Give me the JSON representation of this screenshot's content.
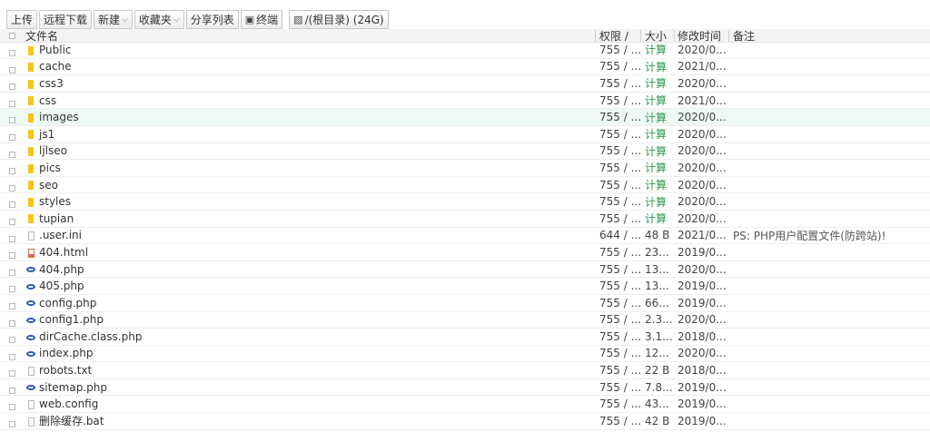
{
  "toolbar": {
    "upload": "上传",
    "remote_download": "远程下载",
    "new": "新建",
    "favorites": "收藏夹",
    "share_list": "分享列表",
    "terminal": "终端",
    "path": "/(根目录) (24G)"
  },
  "header": {
    "name": "文件名",
    "permission": "权限 /",
    "size": "大小",
    "modified": "修改时间",
    "note": "备注"
  },
  "rows": [
    {
      "name": "Public",
      "type": "folder",
      "perm": "755 / ...",
      "size": "计算",
      "time": "2020/0...",
      "note": ""
    },
    {
      "name": "cache",
      "type": "folder",
      "perm": "755 / ...",
      "size": "计算",
      "time": "2021/0...",
      "note": ""
    },
    {
      "name": "css3",
      "type": "folder",
      "perm": "755 / ...",
      "size": "计算",
      "time": "2020/0...",
      "note": ""
    },
    {
      "name": "css",
      "type": "folder",
      "perm": "755 / ...",
      "size": "计算",
      "time": "2021/0...",
      "note": ""
    },
    {
      "name": "images",
      "type": "folder",
      "perm": "755 / ...",
      "size": "计算",
      "time": "2020/0...",
      "note": ""
    },
    {
      "name": "js1",
      "type": "folder",
      "perm": "755 / ...",
      "size": "计算",
      "time": "2020/0...",
      "note": ""
    },
    {
      "name": "ljlseo",
      "type": "folder",
      "perm": "755 / ...",
      "size": "计算",
      "time": "2020/0...",
      "note": ""
    },
    {
      "name": "pics",
      "type": "folder",
      "perm": "755 / ...",
      "size": "计算",
      "time": "2020/0...",
      "note": ""
    },
    {
      "name": "seo",
      "type": "folder",
      "perm": "755 / ...",
      "size": "计算",
      "time": "2020/0...",
      "note": ""
    },
    {
      "name": "styles",
      "type": "folder",
      "perm": "755 / ...",
      "size": "计算",
      "time": "2020/0...",
      "note": ""
    },
    {
      "name": "tupian",
      "type": "folder",
      "perm": "755 / ...",
      "size": "计算",
      "time": "2020/0...",
      "note": ""
    },
    {
      "name": ".user.ini",
      "type": "doc",
      "perm": "644 / ...",
      "size": "48 B",
      "time": "2021/0...",
      "note": "PS: PHP用户配置文件(防跨站)!"
    },
    {
      "name": "404.html",
      "type": "html",
      "perm": "755 / ...",
      "size": "23...",
      "time": "2019/0...",
      "note": ""
    },
    {
      "name": "404.php",
      "type": "php",
      "perm": "755 / ...",
      "size": "13...",
      "time": "2020/0...",
      "note": ""
    },
    {
      "name": "405.php",
      "type": "php",
      "perm": "755 / ...",
      "size": "13...",
      "time": "2019/0...",
      "note": ""
    },
    {
      "name": "config.php",
      "type": "php",
      "perm": "755 / ...",
      "size": "66...",
      "time": "2019/0...",
      "note": ""
    },
    {
      "name": "config1.php",
      "type": "php",
      "perm": "755 / ...",
      "size": "2.3...",
      "time": "2020/0...",
      "note": ""
    },
    {
      "name": "dirCache.class.php",
      "type": "php",
      "perm": "755 / ...",
      "size": "3.1...",
      "time": "2018/0...",
      "note": ""
    },
    {
      "name": "index.php",
      "type": "php",
      "perm": "755 / ...",
      "size": "12...",
      "time": "2020/0...",
      "note": ""
    },
    {
      "name": "robots.txt",
      "type": "doc",
      "perm": "755 / ...",
      "size": "22 B",
      "time": "2018/0...",
      "note": ""
    },
    {
      "name": "sitemap.php",
      "type": "php",
      "perm": "755 / ...",
      "size": "7.8...",
      "time": "2019/0...",
      "note": ""
    },
    {
      "name": "web.config",
      "type": "doc",
      "perm": "755 / ...",
      "size": "43...",
      "time": "2019/0...",
      "note": ""
    },
    {
      "name": "删除缓存.bat",
      "type": "doc",
      "perm": "755 / ...",
      "size": "42 B",
      "time": "2019/0...",
      "note": ""
    }
  ],
  "highlighted_row": "images",
  "colors": {
    "folder": "#f5c518",
    "calc": "#2c9a4e",
    "php": "#2e55b8",
    "highlight": "#eef8f4"
  }
}
